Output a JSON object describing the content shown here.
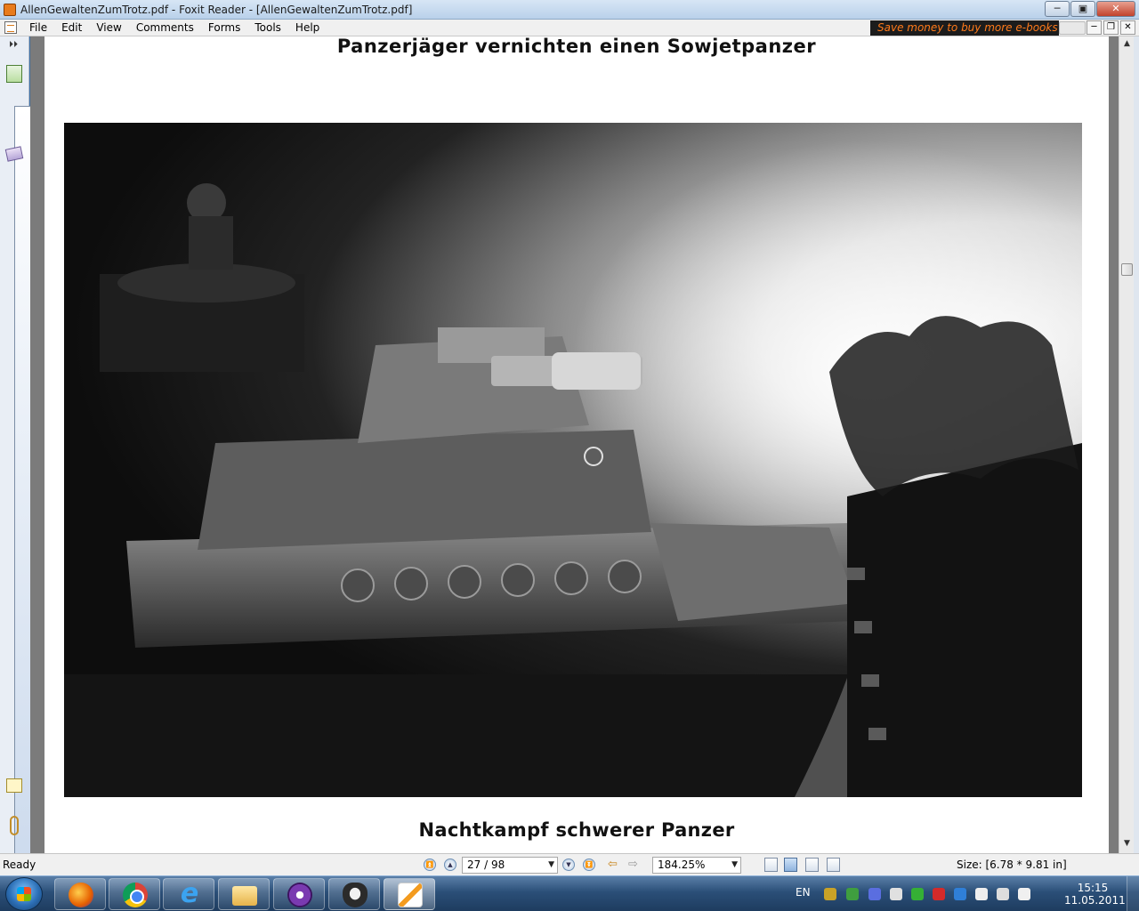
{
  "window": {
    "title": "AllenGewaltenZumTrotz.pdf - Foxit Reader - [AllenGewaltenZumTrotz.pdf]",
    "minimize_glyph": "─",
    "maximize_glyph": "▣",
    "close_glyph": "✕"
  },
  "menubar": {
    "items": [
      "File",
      "Edit",
      "View",
      "Comments",
      "Forms",
      "Tools",
      "Help"
    ],
    "ad_text": "Save money to buy more e-books",
    "mdi_minimize": "─",
    "mdi_restore": "❐",
    "mdi_close": "✕"
  },
  "sidebar": {
    "collapse_glyph": "⏵⏵"
  },
  "document": {
    "top_heading": "Panzerjäger vernichten einen Sowjetpanzer",
    "bottom_heading": "Nachtkampf schwerer Panzer"
  },
  "scrollbar": {
    "up_glyph": "▲",
    "down_glyph": "▼"
  },
  "statusbar": {
    "ready": "Ready",
    "page_indicator": "27 / 98",
    "zoom": "184.25%",
    "size": "Size: [6.78 * 9.81 in]",
    "first_glyph": "⏫",
    "prev_glyph": "▲",
    "next_glyph": "▼",
    "last_glyph": "⏬",
    "back_glyph": "⇦",
    "forward_glyph": "⇨",
    "dropdown_glyph": "▼"
  },
  "taskbar": {
    "apps": [
      "firefox-icon",
      "chrome-icon",
      "ie-icon",
      "explorer-folder-icon",
      "torrent-icon",
      "alien-icon",
      "foxit-icon"
    ],
    "language": "EN",
    "time": "15:15",
    "date": "11.05.2011",
    "tray_colors": [
      "#c9a227",
      "#3f9e3f",
      "#5a6ee0",
      "#e0e0e0",
      "#35b035",
      "#d42a2a",
      "#2f7fd8",
      "#eeeeee",
      "#dddddd",
      "#f0f0f0"
    ]
  }
}
